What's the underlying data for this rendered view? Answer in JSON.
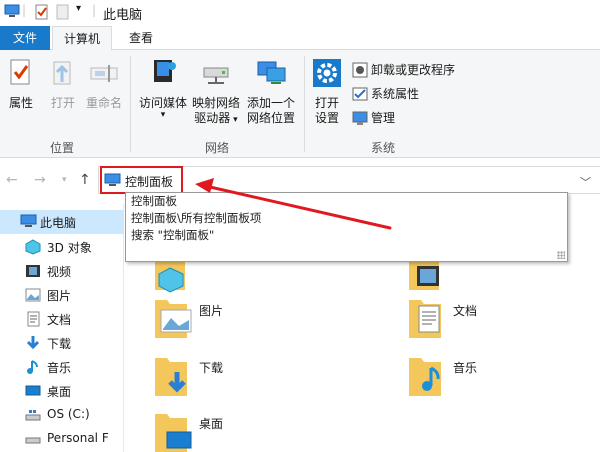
{
  "window": {
    "title": "此电脑"
  },
  "tabs": {
    "file": "文件",
    "computer": "计算机",
    "view": "查看"
  },
  "ribbon": {
    "location": {
      "properties": "属性",
      "open": "打开",
      "rename": "重命名",
      "group": "位置"
    },
    "network": {
      "media": "访问媒体",
      "map_drive_1": "映射网络",
      "map_drive_2": "驱动器",
      "add_location_1": "添加一个",
      "add_location_2": "网络位置",
      "group": "网络"
    },
    "system": {
      "open_settings_1": "打开",
      "open_settings_2": "设置",
      "uninstall": "卸载或更改程序",
      "system_properties": "系统属性",
      "manage": "管理",
      "group": "系统"
    }
  },
  "address": {
    "value": "控制面板"
  },
  "suggestions": [
    "控制面板",
    "控制面板\\所有控制面板项",
    "搜索 \"控制面板\""
  ],
  "sidebar": {
    "items": [
      {
        "label": "此电脑",
        "icon": "pc-icon"
      },
      {
        "label": "3D 对象",
        "icon": "3d-objects-icon"
      },
      {
        "label": "视频",
        "icon": "video-icon"
      },
      {
        "label": "图片",
        "icon": "pictures-icon"
      },
      {
        "label": "文档",
        "icon": "documents-icon"
      },
      {
        "label": "下载",
        "icon": "downloads-icon"
      },
      {
        "label": "音乐",
        "icon": "music-icon"
      },
      {
        "label": "桌面",
        "icon": "desktop-icon"
      },
      {
        "label": "OS (C:)",
        "icon": "drive-icon"
      },
      {
        "label": "Personal F",
        "icon": "drive-icon"
      }
    ]
  },
  "folders": {
    "pictures": "图片",
    "documents": "文档",
    "downloads": "下载",
    "music": "音乐",
    "desktop": "桌面"
  },
  "colors": {
    "accent": "#1979ca",
    "highlight": "#e0191f",
    "selection": "#cce8ff",
    "folder": "#f3c75b"
  }
}
